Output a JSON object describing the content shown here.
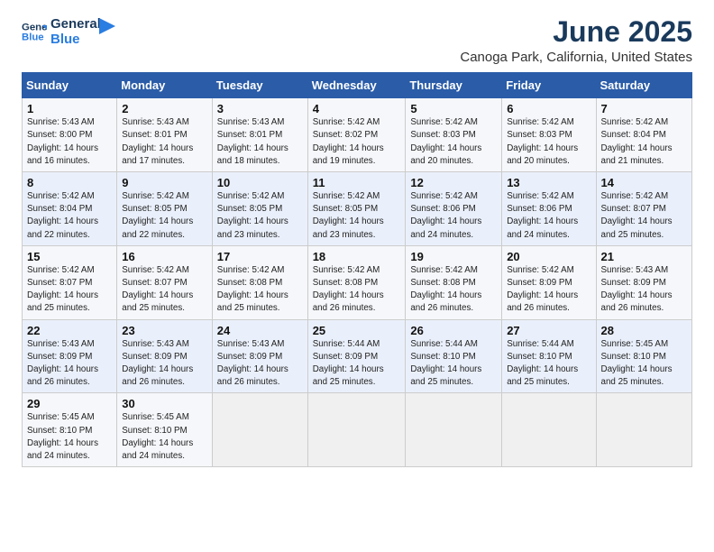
{
  "header": {
    "logo_line1": "General",
    "logo_line2": "Blue",
    "title": "June 2025",
    "subtitle": "Canoga Park, California, United States"
  },
  "calendar": {
    "days_of_week": [
      "Sunday",
      "Monday",
      "Tuesday",
      "Wednesday",
      "Thursday",
      "Friday",
      "Saturday"
    ],
    "weeks": [
      [
        {
          "day": "",
          "info": ""
        },
        {
          "day": "2",
          "info": "Sunrise: 5:43 AM\nSunset: 8:01 PM\nDaylight: 14 hours\nand 17 minutes."
        },
        {
          "day": "3",
          "info": "Sunrise: 5:43 AM\nSunset: 8:01 PM\nDaylight: 14 hours\nand 18 minutes."
        },
        {
          "day": "4",
          "info": "Sunrise: 5:42 AM\nSunset: 8:02 PM\nDaylight: 14 hours\nand 19 minutes."
        },
        {
          "day": "5",
          "info": "Sunrise: 5:42 AM\nSunset: 8:03 PM\nDaylight: 14 hours\nand 20 minutes."
        },
        {
          "day": "6",
          "info": "Sunrise: 5:42 AM\nSunset: 8:03 PM\nDaylight: 14 hours\nand 20 minutes."
        },
        {
          "day": "7",
          "info": "Sunrise: 5:42 AM\nSunset: 8:04 PM\nDaylight: 14 hours\nand 21 minutes."
        }
      ],
      [
        {
          "day": "8",
          "info": "Sunrise: 5:42 AM\nSunset: 8:04 PM\nDaylight: 14 hours\nand 22 minutes."
        },
        {
          "day": "9",
          "info": "Sunrise: 5:42 AM\nSunset: 8:05 PM\nDaylight: 14 hours\nand 22 minutes."
        },
        {
          "day": "10",
          "info": "Sunrise: 5:42 AM\nSunset: 8:05 PM\nDaylight: 14 hours\nand 23 minutes."
        },
        {
          "day": "11",
          "info": "Sunrise: 5:42 AM\nSunset: 8:05 PM\nDaylight: 14 hours\nand 23 minutes."
        },
        {
          "day": "12",
          "info": "Sunrise: 5:42 AM\nSunset: 8:06 PM\nDaylight: 14 hours\nand 24 minutes."
        },
        {
          "day": "13",
          "info": "Sunrise: 5:42 AM\nSunset: 8:06 PM\nDaylight: 14 hours\nand 24 minutes."
        },
        {
          "day": "14",
          "info": "Sunrise: 5:42 AM\nSunset: 8:07 PM\nDaylight: 14 hours\nand 25 minutes."
        }
      ],
      [
        {
          "day": "15",
          "info": "Sunrise: 5:42 AM\nSunset: 8:07 PM\nDaylight: 14 hours\nand 25 minutes."
        },
        {
          "day": "16",
          "info": "Sunrise: 5:42 AM\nSunset: 8:07 PM\nDaylight: 14 hours\nand 25 minutes."
        },
        {
          "day": "17",
          "info": "Sunrise: 5:42 AM\nSunset: 8:08 PM\nDaylight: 14 hours\nand 25 minutes."
        },
        {
          "day": "18",
          "info": "Sunrise: 5:42 AM\nSunset: 8:08 PM\nDaylight: 14 hours\nand 26 minutes."
        },
        {
          "day": "19",
          "info": "Sunrise: 5:42 AM\nSunset: 8:08 PM\nDaylight: 14 hours\nand 26 minutes."
        },
        {
          "day": "20",
          "info": "Sunrise: 5:42 AM\nSunset: 8:09 PM\nDaylight: 14 hours\nand 26 minutes."
        },
        {
          "day": "21",
          "info": "Sunrise: 5:43 AM\nSunset: 8:09 PM\nDaylight: 14 hours\nand 26 minutes."
        }
      ],
      [
        {
          "day": "22",
          "info": "Sunrise: 5:43 AM\nSunset: 8:09 PM\nDaylight: 14 hours\nand 26 minutes."
        },
        {
          "day": "23",
          "info": "Sunrise: 5:43 AM\nSunset: 8:09 PM\nDaylight: 14 hours\nand 26 minutes."
        },
        {
          "day": "24",
          "info": "Sunrise: 5:43 AM\nSunset: 8:09 PM\nDaylight: 14 hours\nand 26 minutes."
        },
        {
          "day": "25",
          "info": "Sunrise: 5:44 AM\nSunset: 8:09 PM\nDaylight: 14 hours\nand 25 minutes."
        },
        {
          "day": "26",
          "info": "Sunrise: 5:44 AM\nSunset: 8:10 PM\nDaylight: 14 hours\nand 25 minutes."
        },
        {
          "day": "27",
          "info": "Sunrise: 5:44 AM\nSunset: 8:10 PM\nDaylight: 14 hours\nand 25 minutes."
        },
        {
          "day": "28",
          "info": "Sunrise: 5:45 AM\nSunset: 8:10 PM\nDaylight: 14 hours\nand 25 minutes."
        }
      ],
      [
        {
          "day": "29",
          "info": "Sunrise: 5:45 AM\nSunset: 8:10 PM\nDaylight: 14 hours\nand 24 minutes."
        },
        {
          "day": "30",
          "info": "Sunrise: 5:45 AM\nSunset: 8:10 PM\nDaylight: 14 hours\nand 24 minutes."
        },
        {
          "day": "",
          "info": ""
        },
        {
          "day": "",
          "info": ""
        },
        {
          "day": "",
          "info": ""
        },
        {
          "day": "",
          "info": ""
        },
        {
          "day": "",
          "info": ""
        }
      ]
    ],
    "week1_sun": {
      "day": "1",
      "info": "Sunrise: 5:43 AM\nSunset: 8:00 PM\nDaylight: 14 hours\nand 16 minutes."
    }
  }
}
